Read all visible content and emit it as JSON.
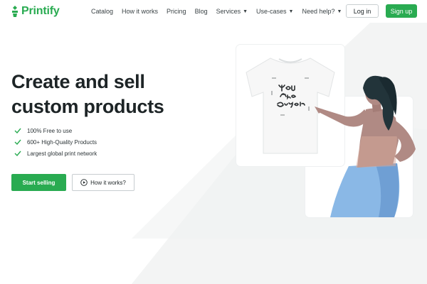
{
  "brand": {
    "name": "Printify",
    "color": "#29ab51"
  },
  "nav": {
    "links": [
      {
        "label": "Catalog",
        "dropdown": false
      },
      {
        "label": "How it works",
        "dropdown": false
      },
      {
        "label": "Pricing",
        "dropdown": false
      },
      {
        "label": "Blog",
        "dropdown": false
      },
      {
        "label": "Services",
        "dropdown": true
      },
      {
        "label": "Use-cases",
        "dropdown": true
      },
      {
        "label": "Need help?",
        "dropdown": true
      }
    ],
    "login_label": "Log in",
    "signup_label": "Sign up"
  },
  "hero": {
    "title_line1": "Create and sell",
    "title_line2": "custom products",
    "features": [
      "100% Free to use",
      "600+ High-Quality Products",
      "Largest global print network"
    ],
    "start_button": "Start selling",
    "how_button": "How it works?"
  },
  "icons": {
    "logo": "printify-logo-icon",
    "check": "check-icon",
    "play": "play-icon",
    "caret": "chevron-down-icon"
  },
  "colors": {
    "accent": "#29ab51",
    "text": "#1d2426",
    "background_shape": "#f2f3f3"
  }
}
